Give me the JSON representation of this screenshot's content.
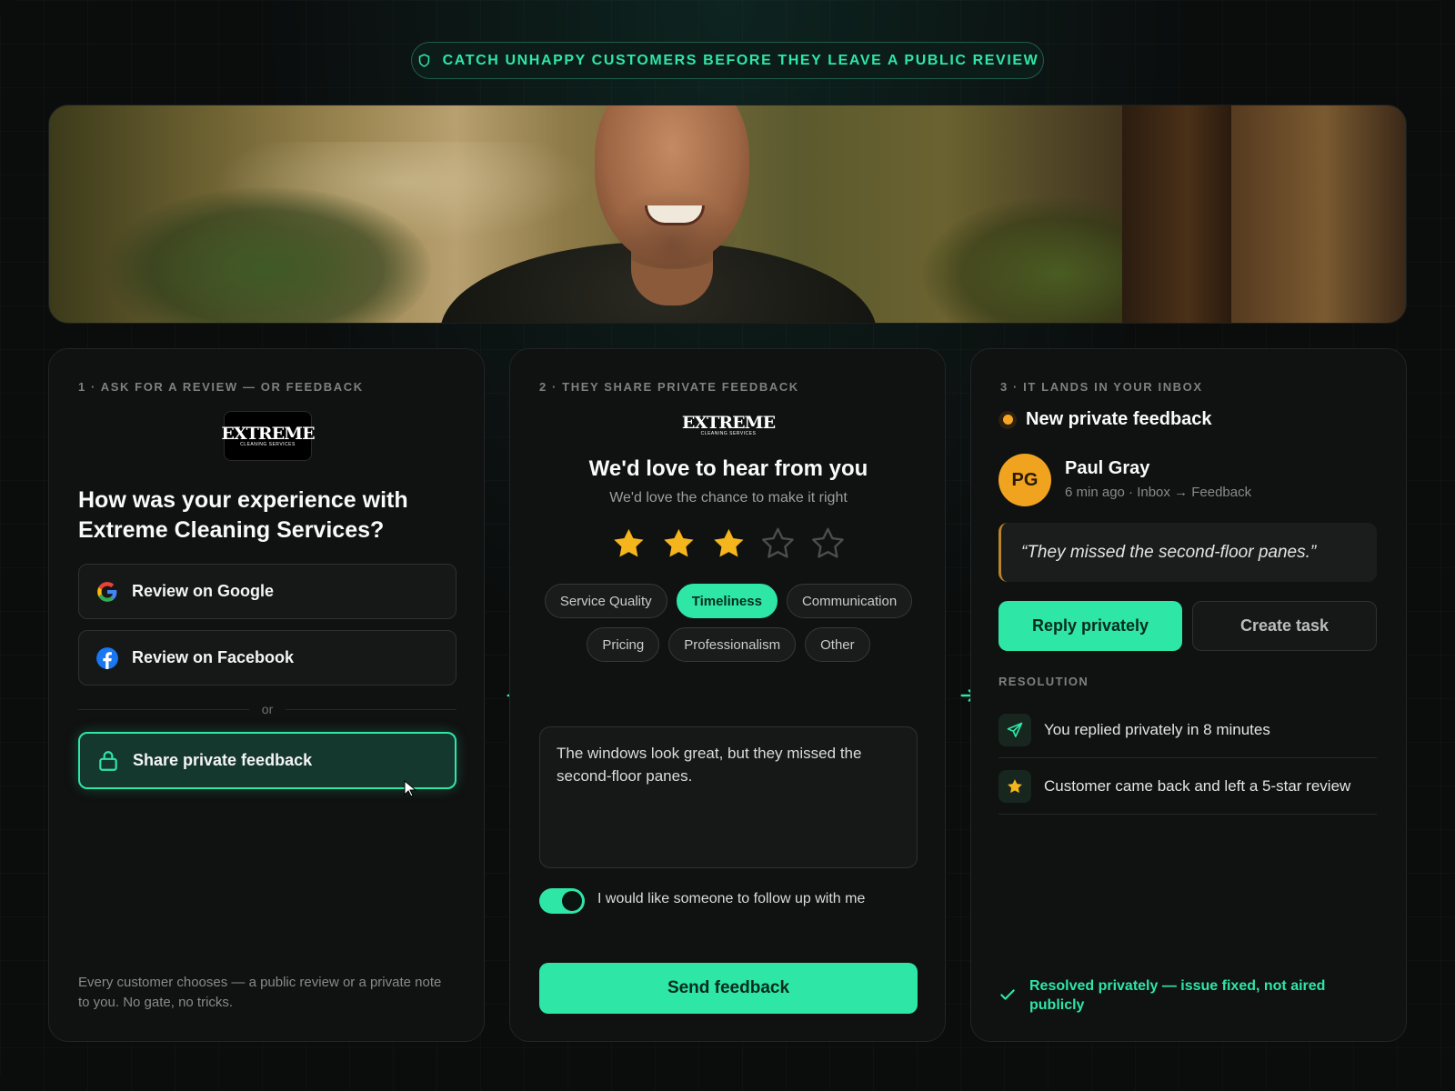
{
  "banner": {
    "text": "CATCH UNHAPPY CUSTOMERS BEFORE THEY LEAVE A PUBLIC REVIEW"
  },
  "colors": {
    "accent": "#2ee6a6",
    "star": "#f5b51c",
    "avatar": "#f0a31f",
    "background": "#0b0d0d"
  },
  "logo": {
    "big": "EXTREME",
    "small": "CLEANING SERVICES"
  },
  "step1": {
    "label": "1 · ASK FOR A REVIEW — OR FEEDBACK",
    "question": "How was your experience with Extreme Cleaning Services?",
    "google_label": "Review on Google",
    "facebook_label": "Review on Facebook",
    "or_label": "or",
    "share_label": "Share private feedback",
    "footer": "Every customer chooses — a public review or a private note to you. No gate, no tricks."
  },
  "step2": {
    "label": "2 · THEY SHARE PRIVATE FEEDBACK",
    "title": "We'd love to hear from you",
    "subtitle": "We'd love the chance to make it right",
    "rating": 3,
    "rating_max": 5,
    "chips": [
      {
        "label": "Service Quality",
        "active": false
      },
      {
        "label": "Timeliness",
        "active": true
      },
      {
        "label": "Communication",
        "active": false
      },
      {
        "label": "Pricing",
        "active": false
      },
      {
        "label": "Professionalism",
        "active": false
      },
      {
        "label": "Other",
        "active": false
      }
    ],
    "feedback_text": "The windows look great, but they missed the second-floor panes.",
    "followup_label": "I would like someone to follow up with me",
    "followup_on": true,
    "send_label": "Send feedback"
  },
  "step3": {
    "label": "3 · IT LANDS IN YOUR INBOX",
    "new_title": "New private feedback",
    "avatar_initials": "PG",
    "name": "Paul Gray",
    "meta": "6 min ago · Inbox → Feedback",
    "quote": "“They missed the second-floor panes.”",
    "reply_label": "Reply privately",
    "task_label": "Create task",
    "resolution_heading": "RESOLUTION",
    "resolution_items": [
      {
        "icon": "send-icon",
        "text": "You replied privately in 8 minutes"
      },
      {
        "icon": "star-icon",
        "text": "Customer came back and left a 5-star review"
      }
    ],
    "resolved_text": "Resolved privately — issue fixed, not aired publicly"
  }
}
